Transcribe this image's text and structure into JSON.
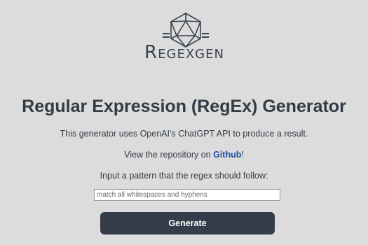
{
  "logo": {
    "icon": "d20-icosahedron-icon",
    "text_prefix": "R",
    "text_rest": "EGEXGEN"
  },
  "main": {
    "title": "Regular Expression (RegEx) Generator",
    "description": "This generator uses OpenAI's ChatGPT API to produce a result.",
    "repo_prefix": "View the repository on ",
    "repo_link": "Github",
    "repo_suffix": "!",
    "instruction": "Input a pattern that the regex should follow:",
    "pattern_input": {
      "value": "",
      "placeholder": "match all whitespaces and hyphens"
    },
    "generate_label": "Generate"
  },
  "colors": {
    "background": "#dcdcdc",
    "text": "#333b45",
    "link": "#1f4ea3",
    "button": "#353d4a"
  }
}
